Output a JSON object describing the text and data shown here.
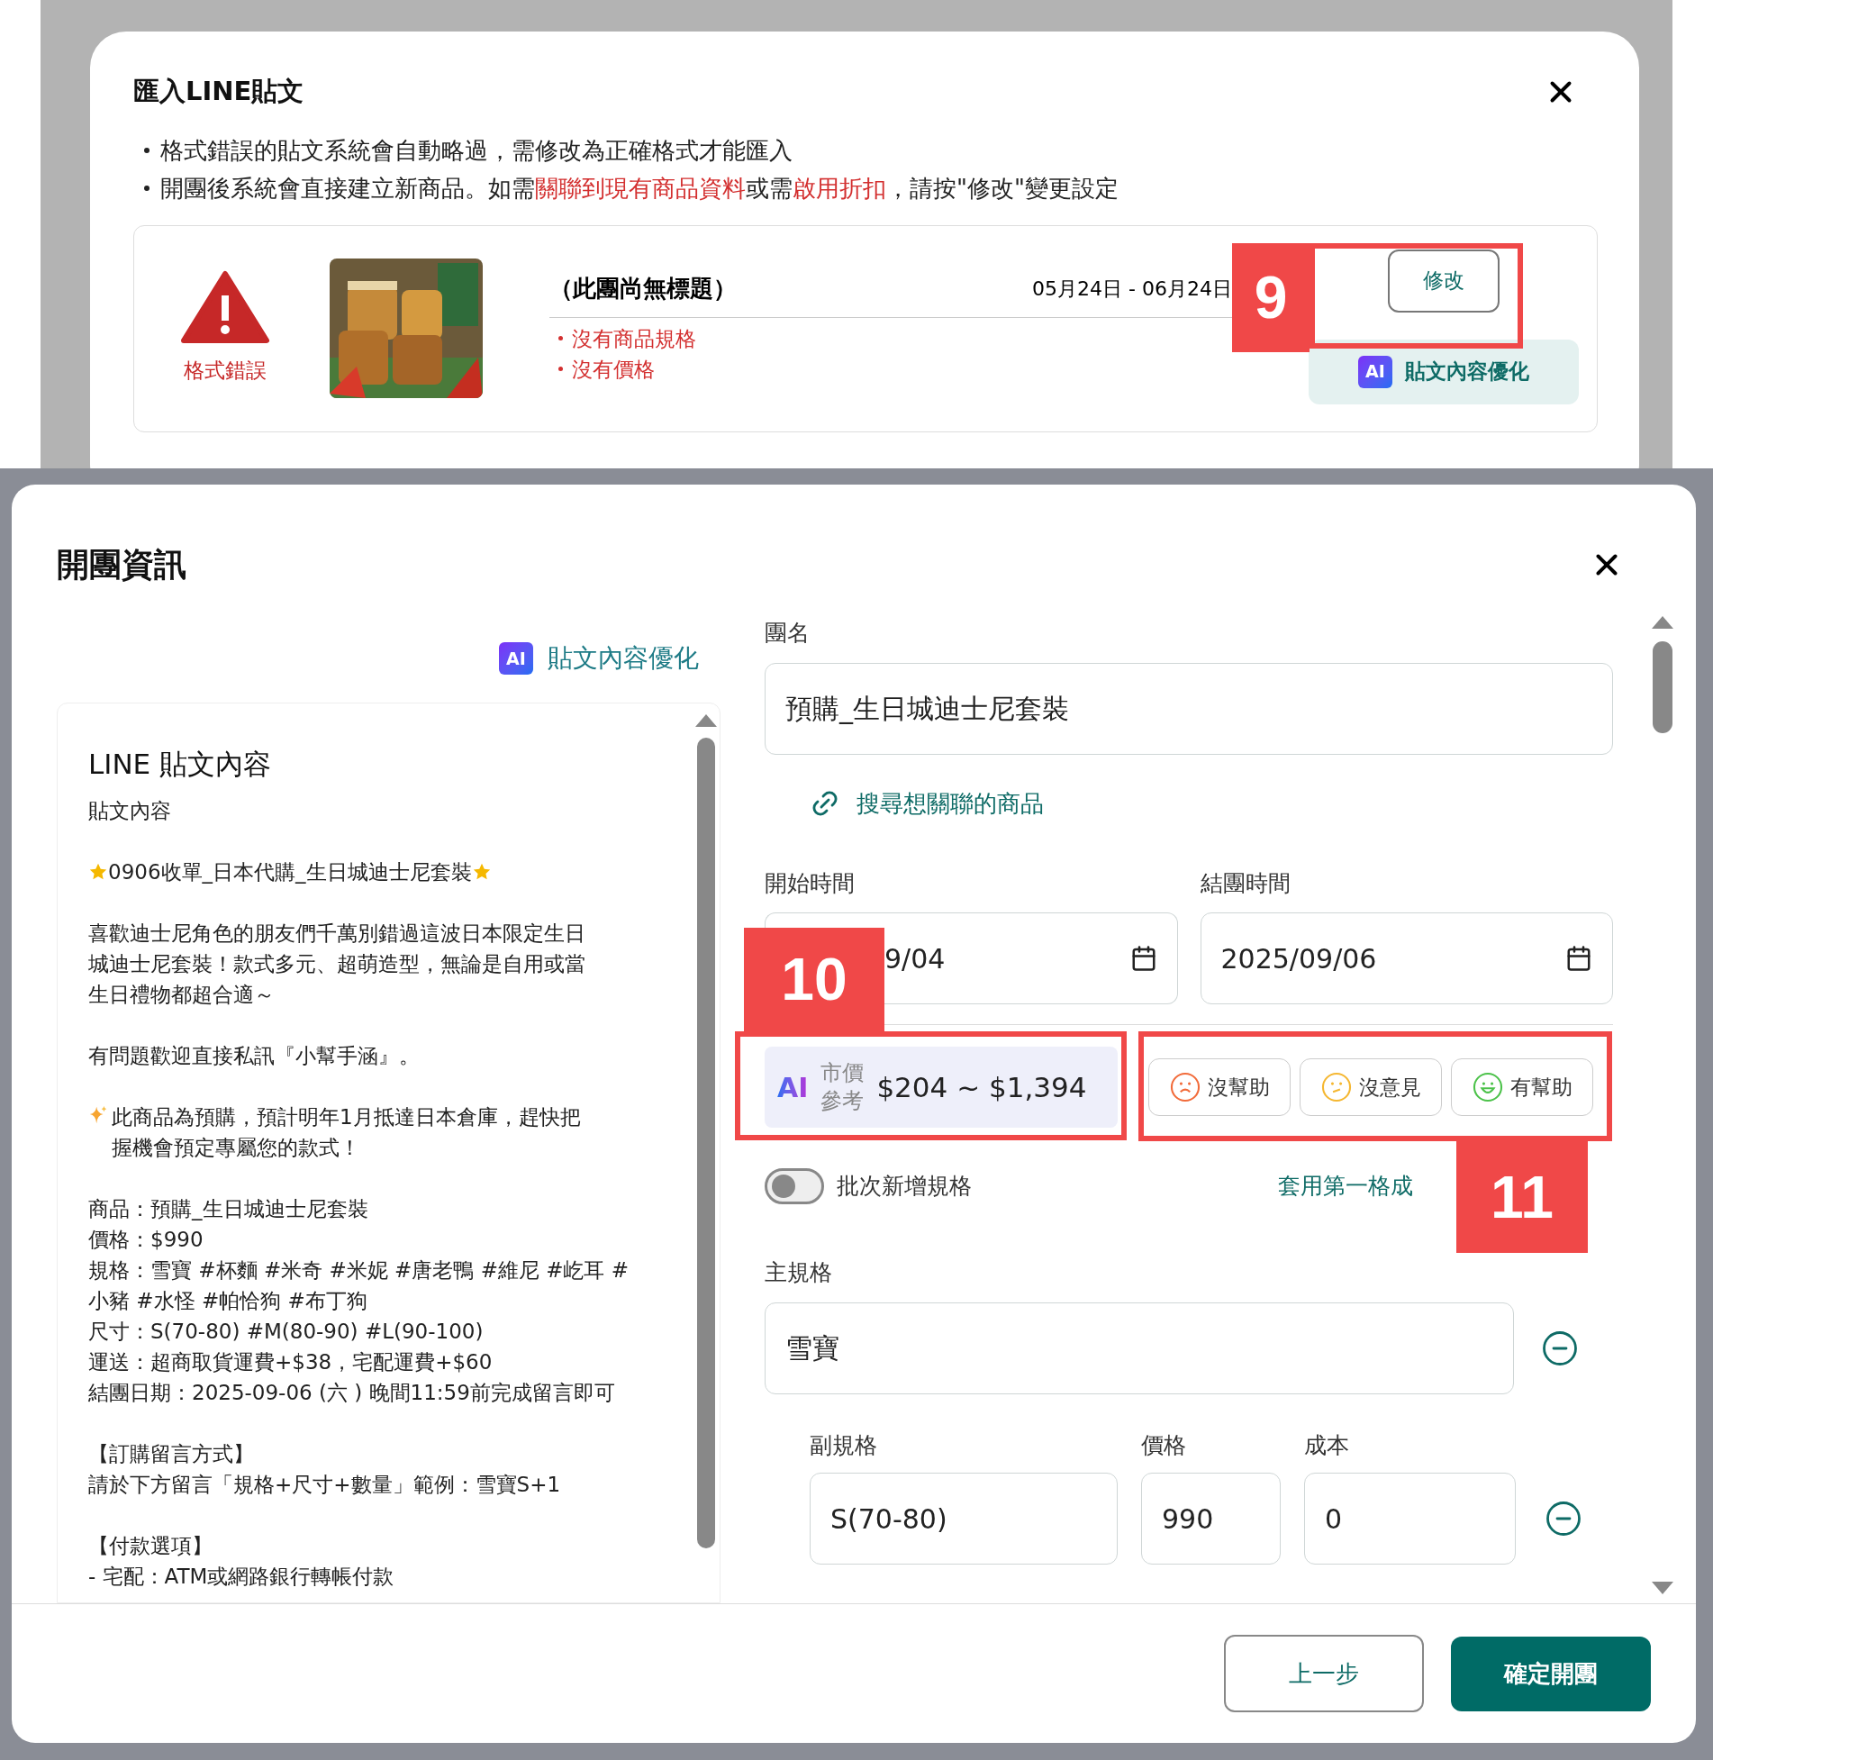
{
  "import_dialog": {
    "title": "匯入LINE貼文",
    "notes": [
      "格式錯誤的貼文系統會自動略過，需修改為正確格式才能匯入",
      "開團後系統會直接建立新商品。如需**關聯到現有商品資料**或需**啟用折扣**，請按\"修改\"變更設定"
    ],
    "post": {
      "status": "格式錯誤",
      "kind": "picture",
      "title": "（此團尚無標題）",
      "dates": "05月24日 - 06月24日",
      "errors": [
        "沒有商品規格",
        "沒有價格"
      ],
      "edit_button": "修改",
      "ai_button": {
        "badge": "AI",
        "label": "貼文內容優化"
      }
    }
  },
  "group_dialog": {
    "title": "開團資訊",
    "ai_link": {
      "badge": "AI",
      "label": "貼文內容優化"
    },
    "post_panel": {
      "title": "LINE 貼文內容",
      "paragraphs": [
        {
          "kind": "plain",
          "lines": [
            "貼文內容"
          ]
        },
        {
          "kind": "starred",
          "lines": [
            "0906收單_日本代購_生日城迪士尼套裝"
          ]
        },
        {
          "kind": "plain",
          "lines": [
            "喜歡迪士尼角色的朋友們千萬別錯過這波日本限定生日",
            "城迪士尼套裝！款式多元、超萌造型，無論是自用或當",
            "生日禮物都超合適～"
          ]
        },
        {
          "kind": "plain",
          "lines": [
            "有問題歡迎直接私訊『小幫手涵』。"
          ]
        },
        {
          "kind": "sparkle",
          "lines": [
            "此商品為預購，預計明年1月抵達日本倉庫，趕快把",
            "握機會預定專屬您的款式！"
          ]
        },
        {
          "kind": "plain",
          "lines": [
            "商品：預購_生日城迪士尼套裝",
            "價格：$990",
            "規格：雪寶 #杯麵 #米奇 #米妮 #唐老鴨 #維尼 #屹耳 #",
            "小豬 #水怪 #帕恰狗 #布丁狗",
            "尺寸：S(70-80) #M(80-90) #L(90-100)",
            "運送：超商取貨運費+$38，宅配運費+$60",
            "結團日期：2025-09-06 (六 ) 晚間11:59前完成留言即可"
          ]
        },
        {
          "kind": "plain",
          "lines": [
            "【訂購留言方式】",
            "請於下方留言「規格+尺寸+數量」範例：雪寶S+1"
          ]
        },
        {
          "kind": "plain",
          "lines": [
            "【付款選項】",
            "- 宅配：ATM或網路銀行轉帳付款"
          ]
        }
      ]
    },
    "form": {
      "name_label": "團名",
      "name_value": "預購_生日城迪士尼套裝",
      "link_label": "搜尋想關聯的商品",
      "start_label": "開始時間",
      "start_value": "9/04",
      "end_label": "結團時間",
      "end_value": "2025/09/06",
      "price": {
        "badge": "AI",
        "label": [
          "市價",
          "參考"
        ],
        "range": "$204 ~ $1,394"
      },
      "feedback": [
        {
          "kind": "sad",
          "color": "#f26b3a",
          "label": "沒幫助"
        },
        {
          "kind": "neutral",
          "color": "#f5b731",
          "label": "沒意見"
        },
        {
          "kind": "happy",
          "color": "#4cc24a",
          "label": "有幫助"
        }
      ],
      "batch_toggle": {
        "label": "批次新增規格",
        "on": false
      },
      "apply_link": "套用第一格成",
      "main_spec_label": "主規格",
      "main_spec_value": "雪寶",
      "sub_headers": [
        "副規格",
        "價格",
        "成本"
      ],
      "sub_row": [
        "S(70-80)",
        "990",
        "0"
      ]
    },
    "buttons": {
      "back": "上一步",
      "confirm": "確定開團"
    }
  },
  "annotations": [
    "9",
    "10",
    "11"
  ]
}
